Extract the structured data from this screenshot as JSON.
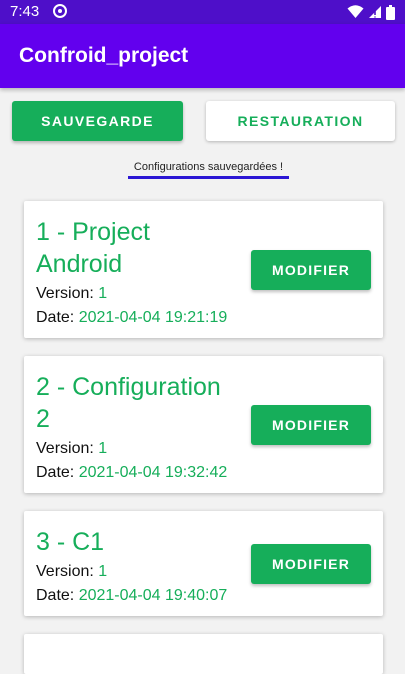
{
  "status_bar": {
    "time": "7:43"
  },
  "app_bar": {
    "title": "Confroid_project"
  },
  "actions": {
    "save_label": "SAUVEGARDE",
    "restore_label": "RESTAURATION"
  },
  "status_message": "Configurations sauvegardées !",
  "labels": {
    "version": "Version: ",
    "date": "Date: "
  },
  "configurations": [
    {
      "name": "1 - Project Android",
      "version": "1",
      "date": "2021-04-04 19:21:19",
      "action": "MODIFIER"
    },
    {
      "name": "2 - Configuration 2",
      "version": "1",
      "date": "2021-04-04 19:32:42",
      "action": "MODIFIER"
    },
    {
      "name": "3 - C1",
      "version": "1",
      "date": "2021-04-04 19:40:07",
      "action": "MODIFIER"
    }
  ],
  "colors": {
    "primary": "#6200ee",
    "status_bar": "#4e0fc9",
    "accent": "#16ae5a",
    "underline": "#2b16d4"
  },
  "icons": [
    "notification-ring-icon",
    "wifi-icon",
    "signal-icon",
    "battery-icon"
  ]
}
